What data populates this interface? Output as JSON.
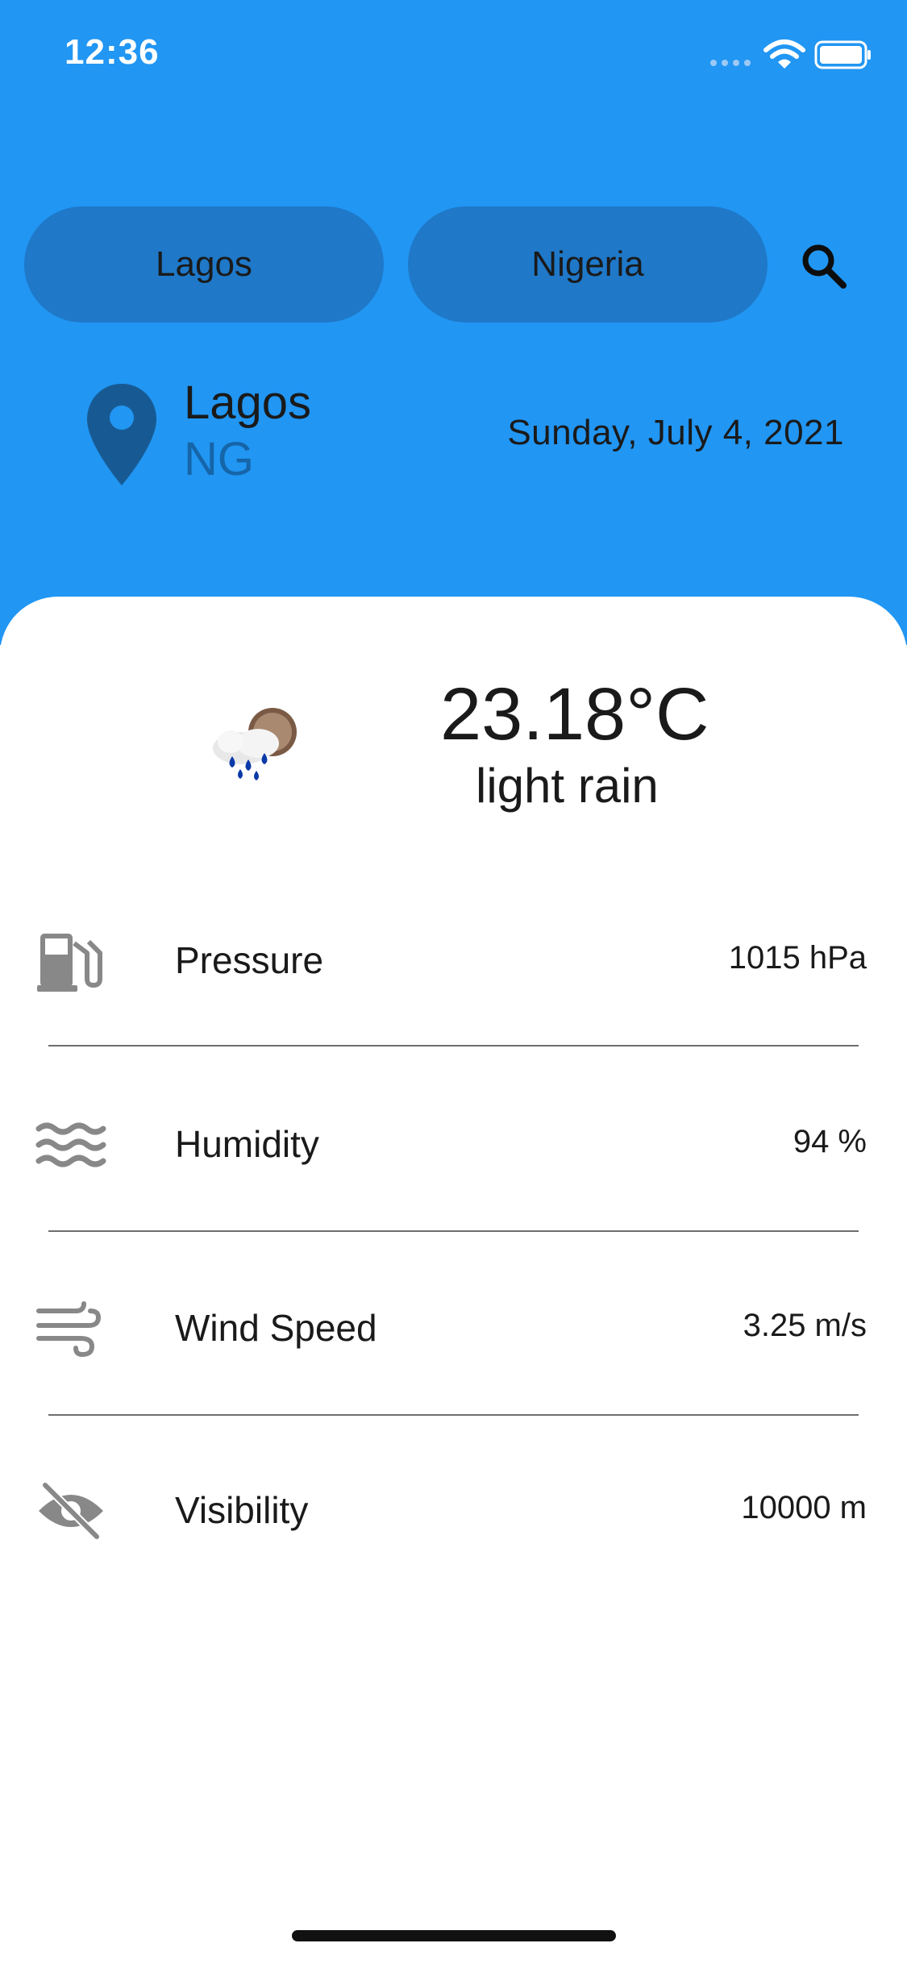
{
  "status_bar": {
    "time": "12:36"
  },
  "search": {
    "city_value": "Lagos",
    "country_value": "Nigeria",
    "search_icon": "search-icon"
  },
  "location": {
    "icon": "location-pin-icon",
    "city": "Lagos",
    "country_code": "NG",
    "date": "Sunday, July 4, 2021"
  },
  "current": {
    "icon": "light-rain-icon",
    "temperature": "23.18°C",
    "condition": "light rain"
  },
  "details": [
    {
      "icon": "fuel-pump-icon",
      "label": "Pressure",
      "value": "1015 hPa"
    },
    {
      "icon": "waves-icon",
      "label": "Humidity",
      "value": "94 %"
    },
    {
      "icon": "wind-icon",
      "label": "Wind Speed",
      "value": "3.25 m/s"
    },
    {
      "icon": "eye-off-icon",
      "label": "Visibility",
      "value": "10000 m"
    }
  ],
  "colors": {
    "header": "#2196f3",
    "field": "#1f78c8",
    "pin": "#175a93",
    "icon_gray": "#888888"
  }
}
